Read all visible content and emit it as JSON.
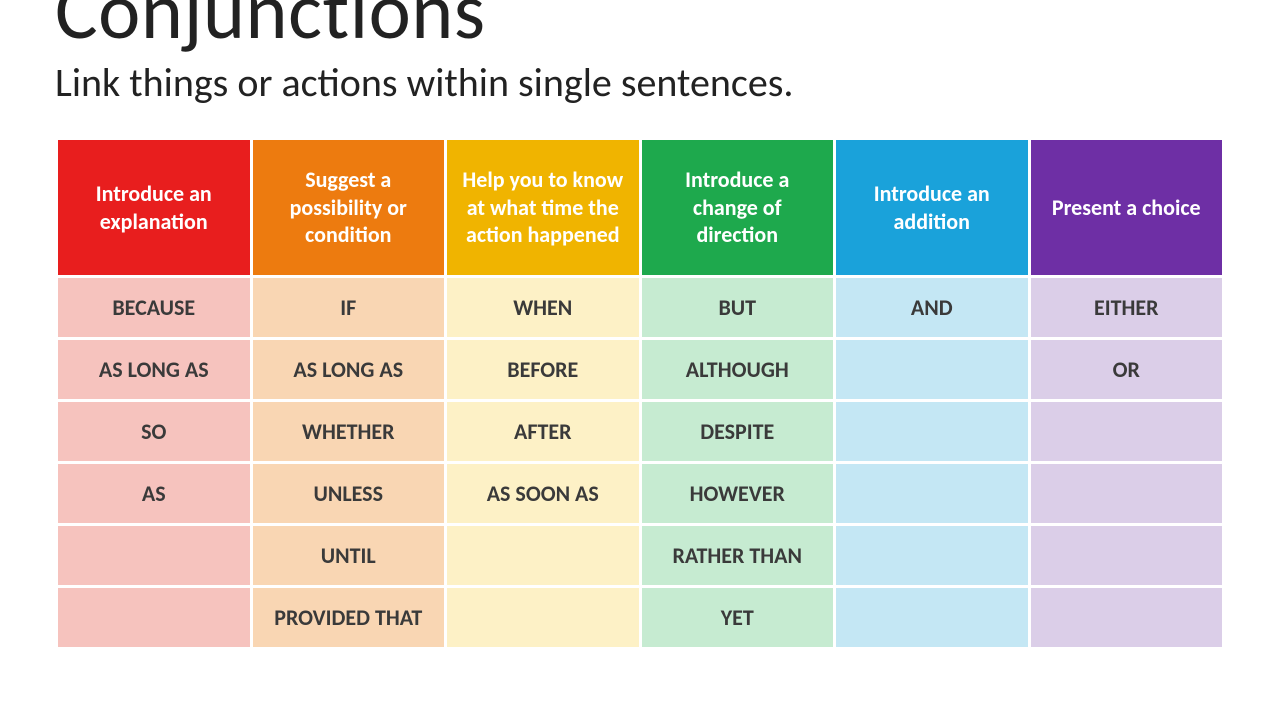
{
  "title": "Conjunctions",
  "subtitle": "Link things or actions within single sentences.",
  "columns": [
    {
      "header": "Introduce an explanation",
      "headerClass": "h-red",
      "cellClass": "c-red",
      "items": [
        "because",
        "as long as",
        "so",
        "as",
        "",
        ""
      ]
    },
    {
      "header": "Suggest a possibility or condition",
      "headerClass": "h-orange",
      "cellClass": "c-orange",
      "items": [
        "if",
        "as long as",
        "whether",
        "unless",
        "until",
        "provided that"
      ]
    },
    {
      "header": "Help you to know at what time the action happened",
      "headerClass": "h-yellow",
      "cellClass": "c-yellow",
      "items": [
        "when",
        "before",
        "after",
        "as soon as",
        "",
        ""
      ]
    },
    {
      "header": "Introduce a change of direction",
      "headerClass": "h-green",
      "cellClass": "c-green",
      "items": [
        "but",
        "although",
        "despite",
        "however",
        "rather than",
        "yet"
      ]
    },
    {
      "header": "Introduce an addition",
      "headerClass": "h-blue",
      "cellClass": "c-blue",
      "items": [
        "and",
        "",
        "",
        "",
        "",
        ""
      ]
    },
    {
      "header": "Present a choice",
      "headerClass": "h-purple",
      "cellClass": "c-purple",
      "items": [
        "either",
        "or",
        "",
        "",
        "",
        ""
      ]
    }
  ],
  "rows": 6
}
